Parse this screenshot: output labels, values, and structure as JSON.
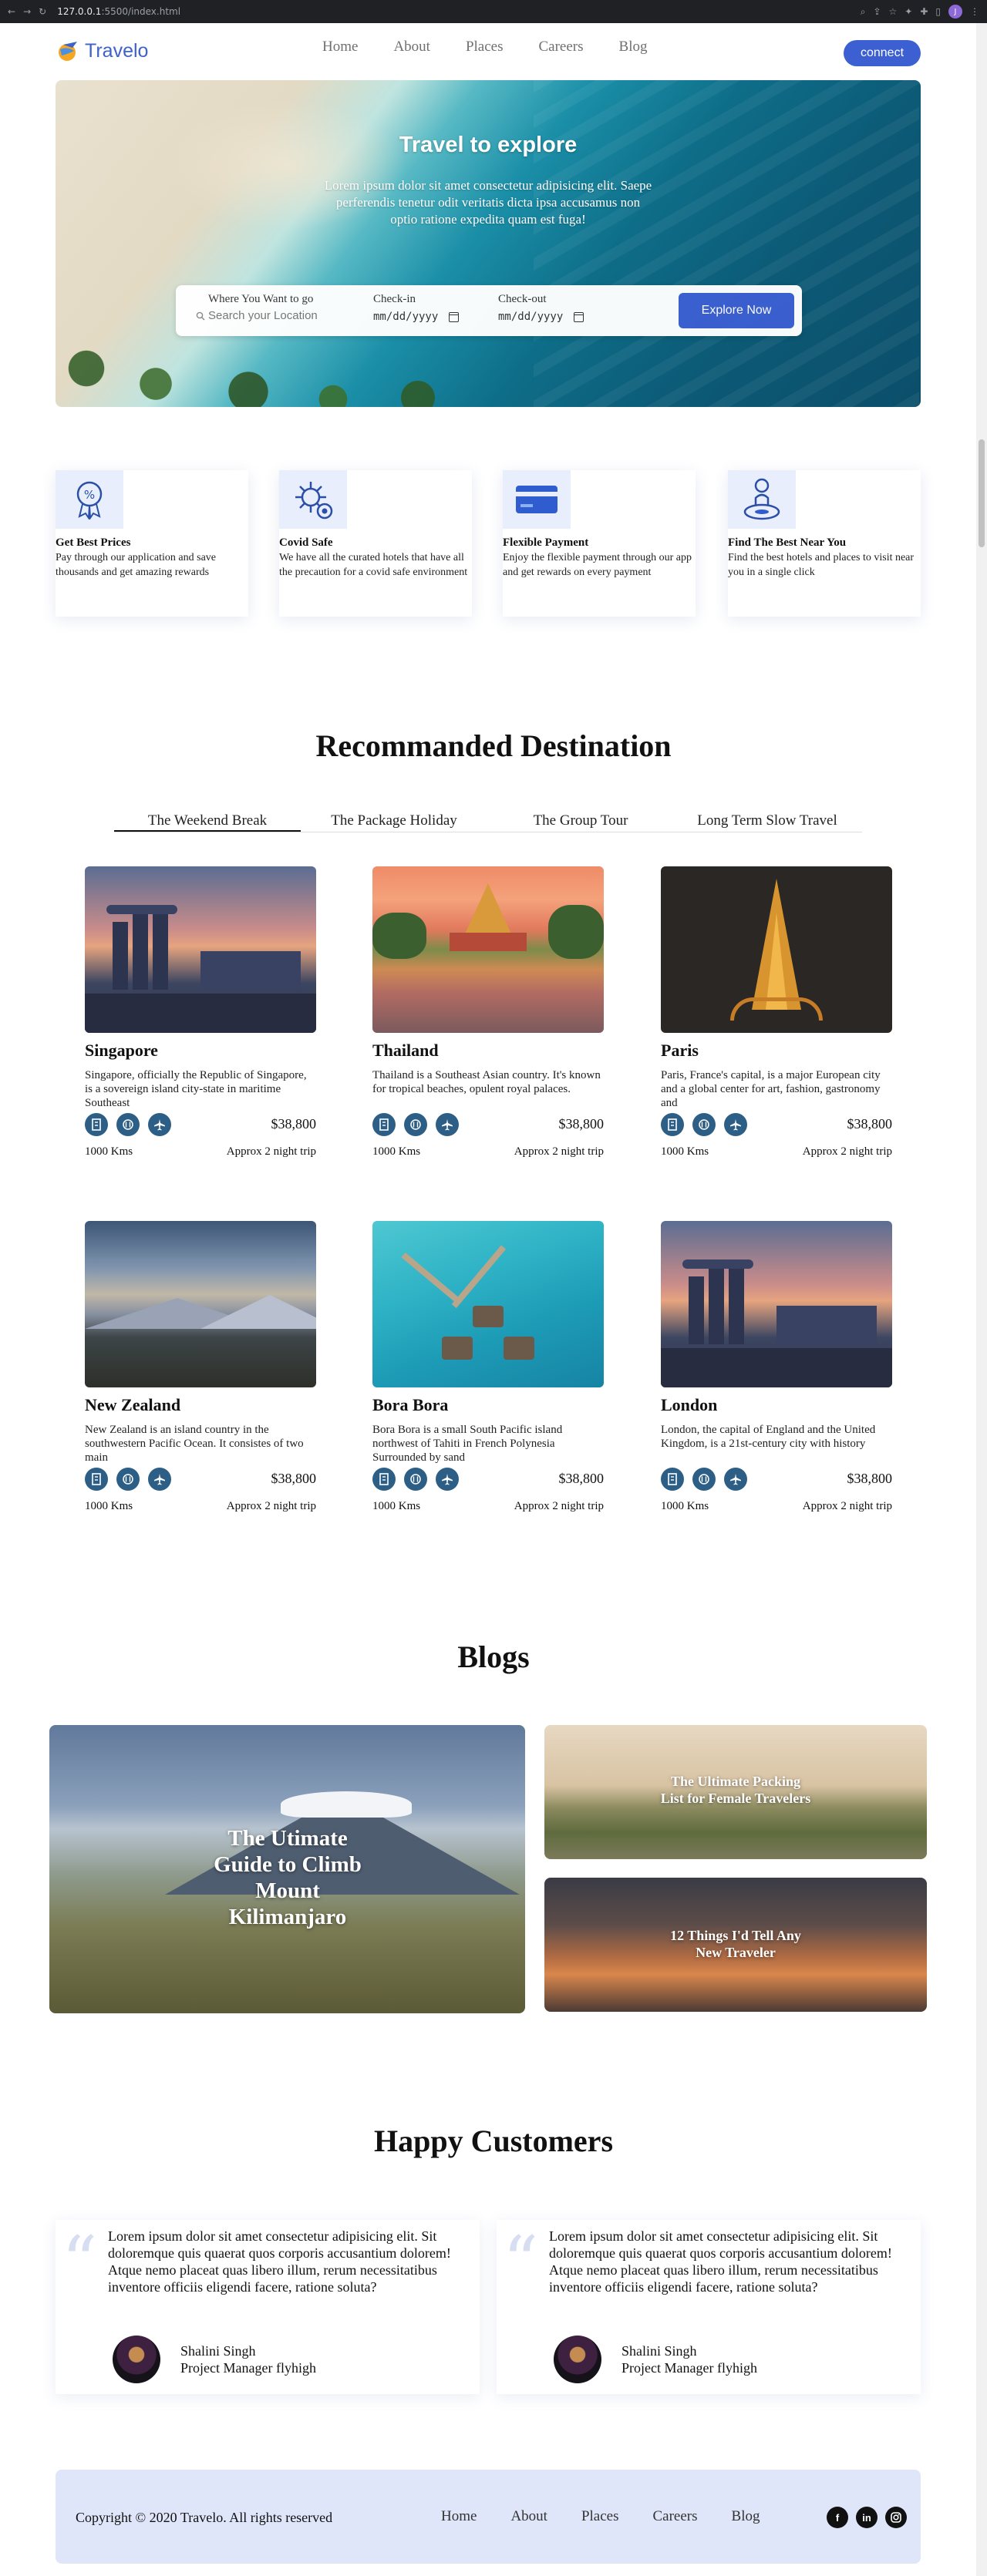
{
  "browser": {
    "url_host": "127.0.0.1",
    "url_path": ":5500/index.html",
    "profile_initial": "J"
  },
  "header": {
    "brand": "Travelo",
    "nav": [
      "Home",
      "About",
      "Places",
      "Careers",
      "Blog"
    ],
    "connect_label": "connect"
  },
  "hero": {
    "title": "Travel to explore",
    "text": "Lorem ipsum dolor sit amet consectetur adipisicing elit. Saepe perferendis tenetur odit veritatis dicta ipsa accusamus non optio ratione expedita quam est fuga!",
    "search": {
      "where_label": "Where You Want to go",
      "where_placeholder": "Search your Location",
      "checkin_label": "Check-in",
      "checkin_value": "mm/dd/yyyy",
      "checkout_label": "Check-out",
      "checkout_value": "mm/dd/yyyy",
      "button_label": "Explore Now"
    }
  },
  "features": [
    {
      "icon": "discount-badge-icon",
      "title": "Get Best Prices",
      "text": "Pay through our application and save thousands and get amazing rewards"
    },
    {
      "icon": "virus-shield-icon",
      "title": "Covid Safe",
      "text": "We have all the curated hotels that have all the precaution for a covid safe environment"
    },
    {
      "icon": "credit-card-icon",
      "title": "Flexible Payment",
      "text": "Enjoy the flexible payment through our app and get rewards on every payment"
    },
    {
      "icon": "location-person-icon",
      "title": "Find The Best Near You",
      "text": "Find the best hotels and places to visit near you in a single click"
    }
  ],
  "destinations": {
    "title": "Recommanded Destination",
    "tabs": [
      "The Weekend Break",
      "The Package Holiday",
      "The Group Tour",
      "Long Term Slow Travel"
    ],
    "active_tab": "The Weekend Break",
    "cards": [
      {
        "name": "Singapore",
        "desc": "Singapore, officially the Republic of Singapore, is a sovereign island city-state in maritime Southeast",
        "price": "$38,800",
        "distance": "1000 Kms",
        "duration": "Approx 2 night trip"
      },
      {
        "name": "Thailand",
        "desc": "Thailand is a Southeast Asian country. It's known for tropical beaches, opulent royal palaces.",
        "price": "$38,800",
        "distance": "1000 Kms",
        "duration": "Approx 2 night trip"
      },
      {
        "name": "Paris",
        "desc": "Paris, France's capital, is a major European city and a global center for art, fashion, gastronomy and",
        "price": "$38,800",
        "distance": "1000 Kms",
        "duration": "Approx 2 night trip"
      },
      {
        "name": "New Zealand",
        "desc": "New Zealand is an island country in the southwestern Pacific Ocean. It consistes of two main",
        "price": "$38,800",
        "distance": "1000 Kms",
        "duration": "Approx 2 night trip"
      },
      {
        "name": "Bora Bora",
        "desc": "Bora Bora is a small South Pacific island northwest of Tahiti in French Polynesia Surrounded by sand",
        "price": "$38,800",
        "distance": "1000 Kms",
        "duration": "Approx 2 night trip"
      },
      {
        "name": "London",
        "desc": "London, the capital of England and the United Kingdom, is a 21st-century city with history",
        "price": "$38,800",
        "distance": "1000 Kms",
        "duration": "Approx 2 night trip"
      }
    ]
  },
  "blogs": {
    "title": "Blogs",
    "posts": [
      "The Utimate Guide to Climb Mount Kilimanjaro",
      "The Ultimate Packing List for Female Travelers",
      "12 Things I'd Tell Any New Traveler"
    ]
  },
  "testimonials": {
    "title": "Happy Customers",
    "items": [
      {
        "text": "Lorem ipsum dolor sit amet consectetur adipisicing elit. Sit doloremque quis quaerat quos corporis accusantium dolorem! Atque nemo placeat quas libero illum, rerum necessitatibus inventore officiis eligendi facere, ratione soluta?",
        "name": "Shalini Singh",
        "role": "Project Manager flyhigh"
      },
      {
        "text": "Lorem ipsum dolor sit amet consectetur adipisicing elit. Sit doloremque quis quaerat quos corporis accusantium dolorem! Atque nemo placeat quas libero illum, rerum necessitatibus inventore officiis eligendi facere, ratione soluta?",
        "name": "Shalini Singh",
        "role": "Project Manager flyhigh"
      }
    ]
  },
  "footer": {
    "copyright": "Copyright © 2020 Travelo. All rights reserved",
    "nav": [
      "Home",
      "About",
      "Places",
      "Careers",
      "Blog"
    ],
    "social": [
      "facebook-icon",
      "linkedin-icon",
      "instagram-icon"
    ]
  },
  "colors": {
    "accent": "#3c5fd1",
    "icon_bg": "#e8eefb",
    "amenity": "#2d5f86",
    "footer_bg": "#dfe6f9"
  }
}
